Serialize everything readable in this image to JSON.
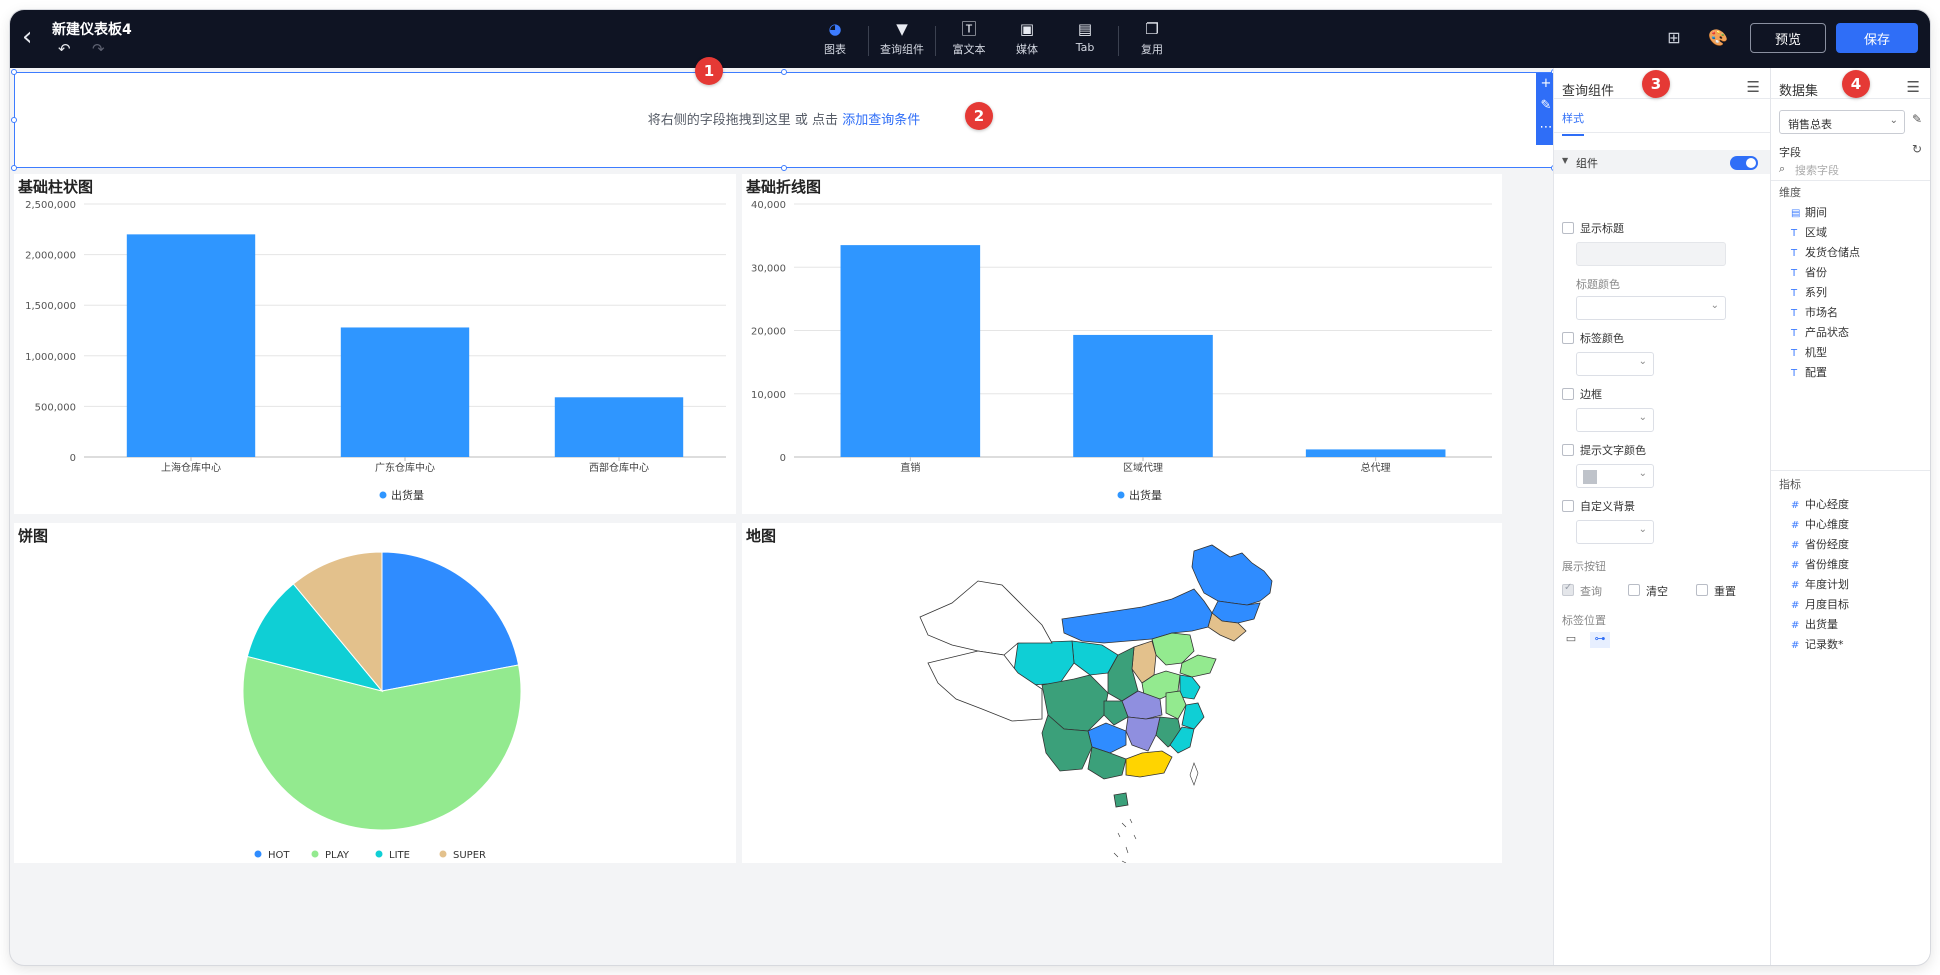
{
  "app": {
    "title": "新建仪表板4"
  },
  "toolbar": {
    "tools": [
      {
        "label": "图表",
        "icon": "pie-chart-icon"
      },
      {
        "label": "查询组件",
        "icon": "filter-icon"
      },
      {
        "label": "富文本",
        "icon": "text-icon"
      },
      {
        "label": "媒体",
        "icon": "image-icon"
      },
      {
        "label": "Tab",
        "icon": "tab-icon"
      },
      {
        "label": "复用",
        "icon": "copy-icon"
      }
    ],
    "preview_label": "预览",
    "save_label": "保存"
  },
  "badges": [
    "1",
    "2",
    "3",
    "4"
  ],
  "query": {
    "hint_prefix": "将右侧的字段拖拽到这里 或 点击",
    "hint_link": "添加查询条件"
  },
  "charts": {
    "bar": {
      "title": "基础柱状图",
      "legend": "出货量"
    },
    "line": {
      "title": "基础折线图",
      "legend": "出货量"
    },
    "pie": {
      "title": "饼图"
    },
    "map": {
      "title": "地图"
    }
  },
  "chart_data": [
    {
      "type": "bar",
      "title": "基础柱状图",
      "categories": [
        "上海仓库中心",
        "广东仓库中心",
        "西部仓库中心"
      ],
      "series": [
        {
          "name": "出货量",
          "values": [
            2200000,
            1280000,
            590000
          ]
        }
      ],
      "ylim": [
        0,
        2500000
      ],
      "yticks": [
        "0",
        "500,000",
        "1,000,000",
        "1,500,000",
        "2,000,000",
        "2,500,000"
      ],
      "grid": true,
      "legend_position": "bottom",
      "color": "#2f96ff"
    },
    {
      "type": "bar",
      "title": "基础折线图",
      "categories": [
        "直销",
        "区域代理",
        "总代理"
      ],
      "series": [
        {
          "name": "出货量",
          "values": [
            33500,
            19300,
            1200
          ]
        }
      ],
      "ylim": [
        0,
        40000
      ],
      "yticks": [
        "0",
        "10,000",
        "20,000",
        "30,000",
        "40,000"
      ],
      "grid": true,
      "legend_position": "bottom",
      "color": "#2f96ff"
    },
    {
      "type": "pie",
      "title": "饼图",
      "slices": [
        {
          "label": "HOT",
          "value": 22,
          "color": "#2f8cff"
        },
        {
          "label": "PLAY",
          "value": 57,
          "color": "#93ea8f"
        },
        {
          "label": "LITE",
          "value": 10,
          "color": "#0fcfd5"
        },
        {
          "label": "SUPER",
          "value": 11,
          "color": "#e3c18c"
        }
      ],
      "legend_position": "bottom"
    }
  ],
  "panel3": {
    "title": "查询组件",
    "tab": "样式",
    "section": "组件",
    "show_title": "显示标题",
    "title_color": "标题颜色",
    "label_color": "标签颜色",
    "border": "边框",
    "hint_text_color": "提示文字颜色",
    "custom_bg": "自定义背景",
    "show_buttons": "展示按钮",
    "btn_query": "查询",
    "btn_clear": "清空",
    "btn_reset": "重置",
    "label_position": "标签位置"
  },
  "panel4": {
    "title": "数据集",
    "dataset": "销售总表",
    "fields_label": "字段",
    "search_placeholder": "搜索字段",
    "dimension_label": "维度",
    "dimensions": [
      "期间",
      "区域",
      "发货仓储点",
      "省份",
      "系列",
      "市场名",
      "产品状态",
      "机型",
      "配置"
    ],
    "measure_label": "指标",
    "measures": [
      "中心经度",
      "中心维度",
      "省份经度",
      "省份维度",
      "年度计划",
      "月度目标",
      "出货量",
      "记录数*"
    ]
  }
}
